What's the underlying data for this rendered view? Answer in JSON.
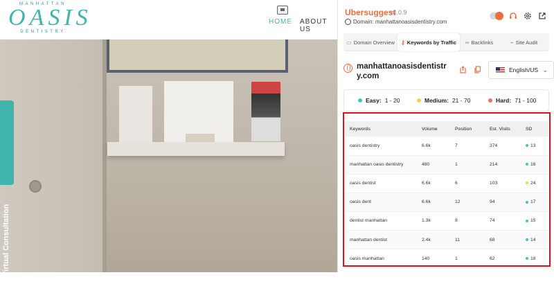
{
  "site": {
    "logo_top": "MANHATTAN",
    "logo_main": "OASIS",
    "logo_bottom": "DENTISTRY",
    "nav_home": "HOME",
    "nav_about": "ABOUT US",
    "virtual_consultation": "Virtual Consultation",
    "vc_close": "×"
  },
  "extension": {
    "name": "Ubersuggest",
    "version": "v4.0.9",
    "domain_label": "Domain: manhattanoasisdentistry.com",
    "tabs": [
      {
        "label": "Domain Overview",
        "icon": "monitor-icon"
      },
      {
        "label": "Keywords by Traffic",
        "icon": "key-icon"
      },
      {
        "label": "Backlinks",
        "icon": "link-icon"
      },
      {
        "label": "Site Audit",
        "icon": "chart-icon"
      }
    ],
    "active_tab": "Keywords by Traffic",
    "site_name": "manhattanoasisdentistry.com",
    "language": "English/US",
    "legend": {
      "easy": {
        "label": "Easy:",
        "range": "1 - 20",
        "color": "#46c9b0"
      },
      "medium": {
        "label": "Medium:",
        "range": "21 - 70",
        "color": "#f2d44a"
      },
      "hard": {
        "label": "Hard:",
        "range": "71 - 100",
        "color": "#f0706a"
      }
    },
    "table": {
      "headers": [
        "Keywords",
        "Volume",
        "Position",
        "Est. Visits",
        "SD"
      ],
      "rows": [
        {
          "keyword": "oasis dentistry",
          "volume": "6.6k",
          "position": "7",
          "visits": "374",
          "sd": "13",
          "level": "easy"
        },
        {
          "keyword": "manhattan oasis dentistry",
          "volume": "480",
          "position": "1",
          "visits": "214",
          "sd": "16",
          "level": "easy"
        },
        {
          "keyword": "oasis dentist",
          "volume": "6.6k",
          "position": "6",
          "visits": "103",
          "sd": "24",
          "level": "medium"
        },
        {
          "keyword": "oasis dent",
          "volume": "6.6k",
          "position": "12",
          "visits": "94",
          "sd": "17",
          "level": "easy"
        },
        {
          "keyword": "dentist manhattan",
          "volume": "1.3k",
          "position": "8",
          "visits": "74",
          "sd": "15",
          "level": "easy"
        },
        {
          "keyword": "manhattan dentist",
          "volume": "2.4k",
          "position": "11",
          "visits": "68",
          "sd": "14",
          "level": "easy"
        },
        {
          "keyword": "oasis manhattan",
          "volume": "140",
          "position": "1",
          "visits": "62",
          "sd": "18",
          "level": "easy"
        }
      ]
    },
    "colors": {
      "brand": "#f36c3d",
      "highlight_border": "#e0101a",
      "site_accent": "#3fb5ae"
    }
  }
}
